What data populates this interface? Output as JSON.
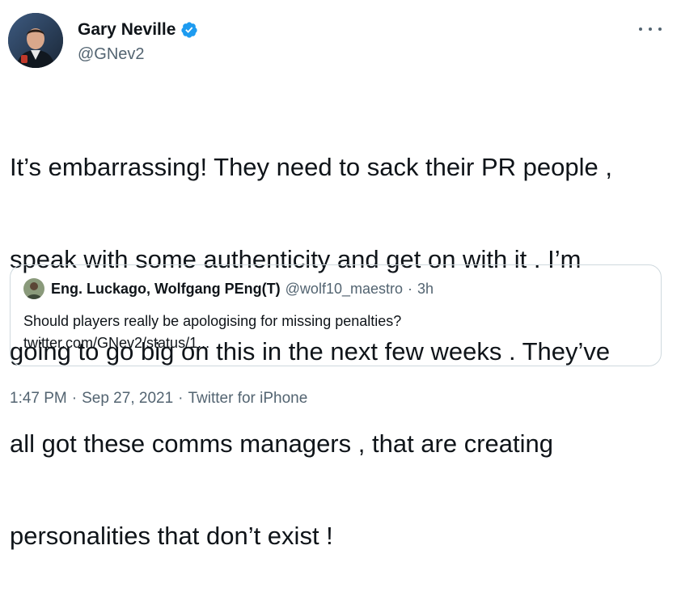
{
  "tweet": {
    "author_name": "Gary Neville",
    "author_handle": "@GNev2",
    "verified_icon": "verified-badge-icon",
    "more_icon": "more-options-icon",
    "text": "It’s embarrassing! They need to sack their PR people , speak with some authenticity and get on with it . I’m going to go big on this in the next few weeks . They’ve all got these comms managers , that are creating personalities that don’t exist !",
    "text_lines": [
      "It’s embarrassing! They need to sack their PR people ,",
      "speak with some authenticity and get on with it . I’m",
      "going to go big on this in the next few weeks . They’ve",
      "all got these comms managers , that are creating",
      "personalities that don’t exist !"
    ],
    "time": "1:47 PM",
    "date": "Sep 27, 2021",
    "source": "Twitter for iPhone"
  },
  "quote": {
    "author_name": "Eng. Luckago, Wolfgang PEng(T)",
    "author_handle": "@wolf10_maestro",
    "age": "3h",
    "text": "Should players really be apologising for missing penalties?",
    "link": "twitter.com/GNev2/status/1..."
  },
  "colors": {
    "text": "#0f1419",
    "secondary": "#536471",
    "verified": "#1d9bf0",
    "border": "#cfd9de"
  }
}
